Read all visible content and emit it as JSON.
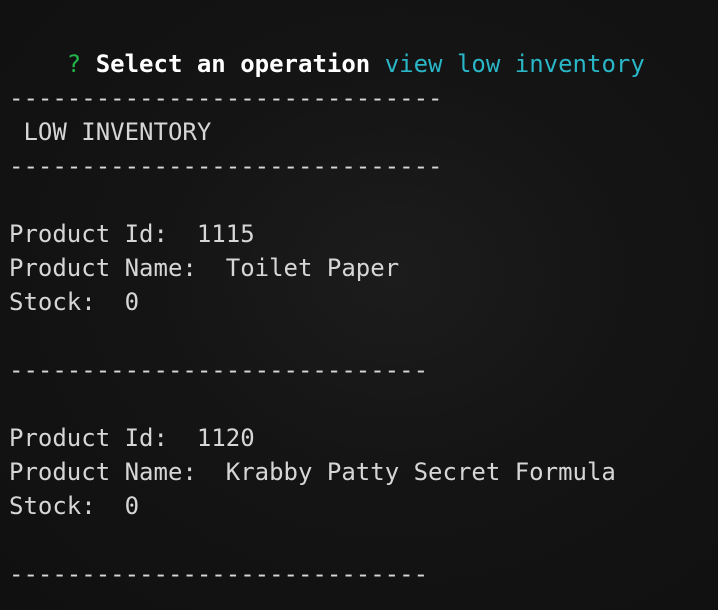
{
  "prompt": {
    "marker": "?",
    "question": "Select an operation",
    "answer": "view low inventory"
  },
  "report": {
    "rule_long": "------------------------------",
    "title": " LOW INVENTORY",
    "rule_short": "-----------------------------"
  },
  "products": [
    {
      "id_label": "Product Id:  ",
      "id": "1115",
      "name_label": "Product Name:  ",
      "name": "Toilet Paper",
      "stock_label": "Stock:  ",
      "stock": "0"
    },
    {
      "id_label": "Product Id:  ",
      "id": "1120",
      "name_label": "Product Name:  ",
      "name": "Krabby Patty Secret Formula",
      "stock_label": "Stock:  ",
      "stock": "0"
    }
  ],
  "colors": {
    "background": "#131313",
    "text": "#d6d6d6",
    "prompt_mark": "#22b64a",
    "answer": "#29b6c6"
  }
}
